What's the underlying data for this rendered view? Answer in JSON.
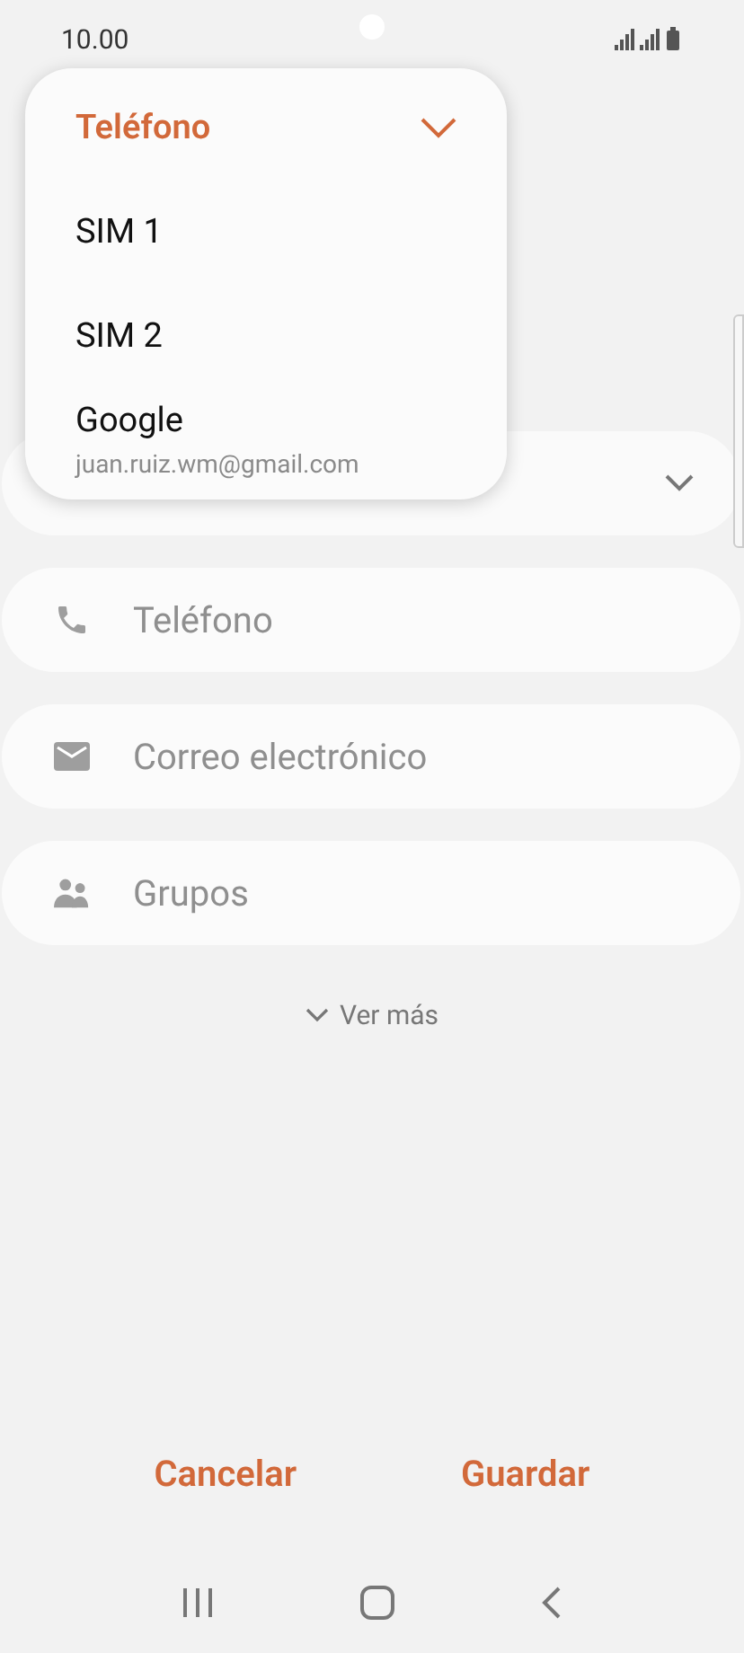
{
  "status_bar": {
    "time": "10.00"
  },
  "menu": {
    "items": [
      {
        "label": "Teléfono",
        "selected": true
      },
      {
        "label": "SIM 1",
        "selected": false
      },
      {
        "label": "SIM 2",
        "selected": false
      },
      {
        "label": "Google",
        "subtitle": "juan.ruiz.wm@gmail.com",
        "selected": false
      }
    ]
  },
  "fields": [
    {
      "kind": "phone",
      "placeholder": "Teléfono"
    },
    {
      "kind": "email",
      "placeholder": "Correo electrónico"
    },
    {
      "kind": "groups",
      "placeholder": "Grupos"
    }
  ],
  "more_link": "Ver más",
  "buttons": [
    "Cancelar",
    "Guardar"
  ]
}
